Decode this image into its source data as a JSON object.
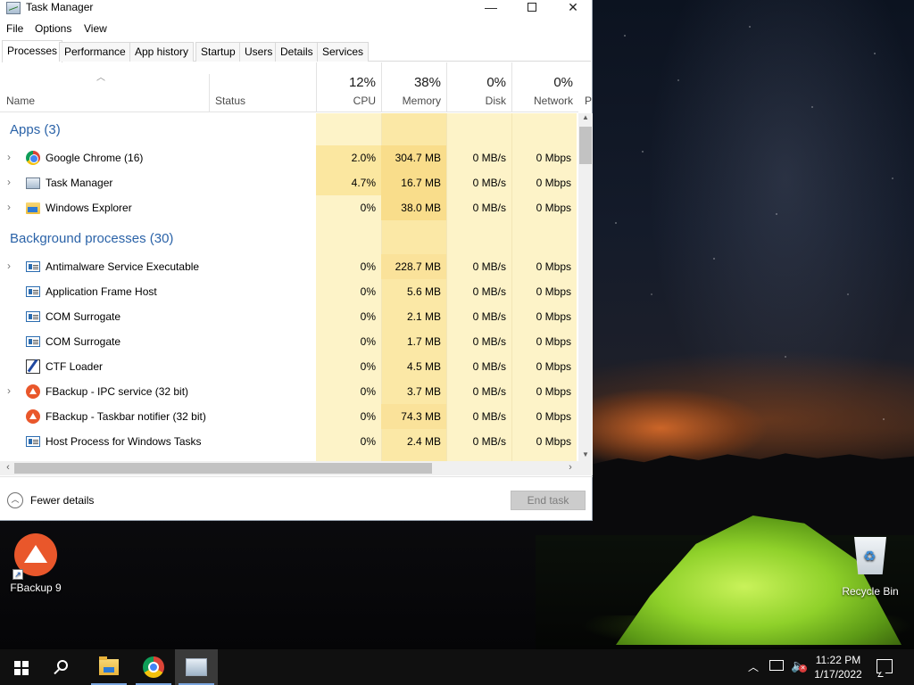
{
  "window": {
    "title": "Task Manager",
    "controls": {
      "minimize": "—",
      "maximize": "",
      "close": "✕"
    }
  },
  "menu": [
    "File",
    "Options",
    "View"
  ],
  "tabs": [
    "Processes",
    "Performance",
    "App history",
    "Startup",
    "Users",
    "Details",
    "Services"
  ],
  "active_tab": "Processes",
  "columns": {
    "name": "Name",
    "status": "Status",
    "cpu": {
      "pct": "12%",
      "label": "CPU"
    },
    "memory": {
      "pct": "38%",
      "label": "Memory"
    },
    "disk": {
      "pct": "0%",
      "label": "Disk"
    },
    "network": {
      "pct": "0%",
      "label": "Network"
    },
    "power_partial": "P"
  },
  "groups": {
    "apps": {
      "title": "Apps (3)"
    },
    "background": {
      "title": "Background processes (30)"
    }
  },
  "apps": [
    {
      "name": "Google Chrome (16)",
      "cpu": "2.0%",
      "memory": "304.7 MB",
      "disk": "0 MB/s",
      "network": "0 Mbps",
      "icon": "chrome-icon"
    },
    {
      "name": "Task Manager",
      "cpu": "4.7%",
      "memory": "16.7 MB",
      "disk": "0 MB/s",
      "network": "0 Mbps",
      "icon": "task-manager-icon"
    },
    {
      "name": "Windows Explorer",
      "cpu": "0%",
      "memory": "38.0 MB",
      "disk": "0 MB/s",
      "network": "0 Mbps",
      "icon": "file-explorer-icon"
    }
  ],
  "background": [
    {
      "name": "Antimalware Service Executable",
      "cpu": "0%",
      "memory": "228.7 MB",
      "disk": "0 MB/s",
      "network": "0 Mbps",
      "icon": "service-icon"
    },
    {
      "name": "Application Frame Host",
      "cpu": "0%",
      "memory": "5.6 MB",
      "disk": "0 MB/s",
      "network": "0 Mbps",
      "icon": "service-icon"
    },
    {
      "name": "COM Surrogate",
      "cpu": "0%",
      "memory": "2.1 MB",
      "disk": "0 MB/s",
      "network": "0 Mbps",
      "icon": "service-icon"
    },
    {
      "name": "COM Surrogate",
      "cpu": "0%",
      "memory": "1.7 MB",
      "disk": "0 MB/s",
      "network": "0 Mbps",
      "icon": "service-icon"
    },
    {
      "name": "CTF Loader",
      "cpu": "0%",
      "memory": "4.5 MB",
      "disk": "0 MB/s",
      "network": "0 Mbps",
      "icon": "ctf-loader-icon"
    },
    {
      "name": "FBackup - IPC service (32 bit)",
      "cpu": "0%",
      "memory": "3.7 MB",
      "disk": "0 MB/s",
      "network": "0 Mbps",
      "icon": "fbackup-icon"
    },
    {
      "name": "FBackup - Taskbar notifier (32 bit)",
      "cpu": "0%",
      "memory": "74.3 MB",
      "disk": "0 MB/s",
      "network": "0 Mbps",
      "icon": "fbackup-icon"
    },
    {
      "name": "Host Process for Windows Tasks",
      "cpu": "0%",
      "memory": "2.4 MB",
      "disk": "0 MB/s",
      "network": "0 Mbps",
      "icon": "service-icon"
    }
  ],
  "footer": {
    "fewer_details": "Fewer details",
    "end_task": "End task"
  },
  "desktop": {
    "fbackup": "FBackup 9",
    "recycle_bin": "Recycle Bin"
  },
  "taskbar": {
    "time": "11:22 PM",
    "date": "1/17/2022"
  },
  "colors": {
    "group_header": "#2b63a8",
    "heat_light": "#fdf3c8",
    "heat_medium": "#fbe8a6",
    "taskbar": "#101010"
  }
}
